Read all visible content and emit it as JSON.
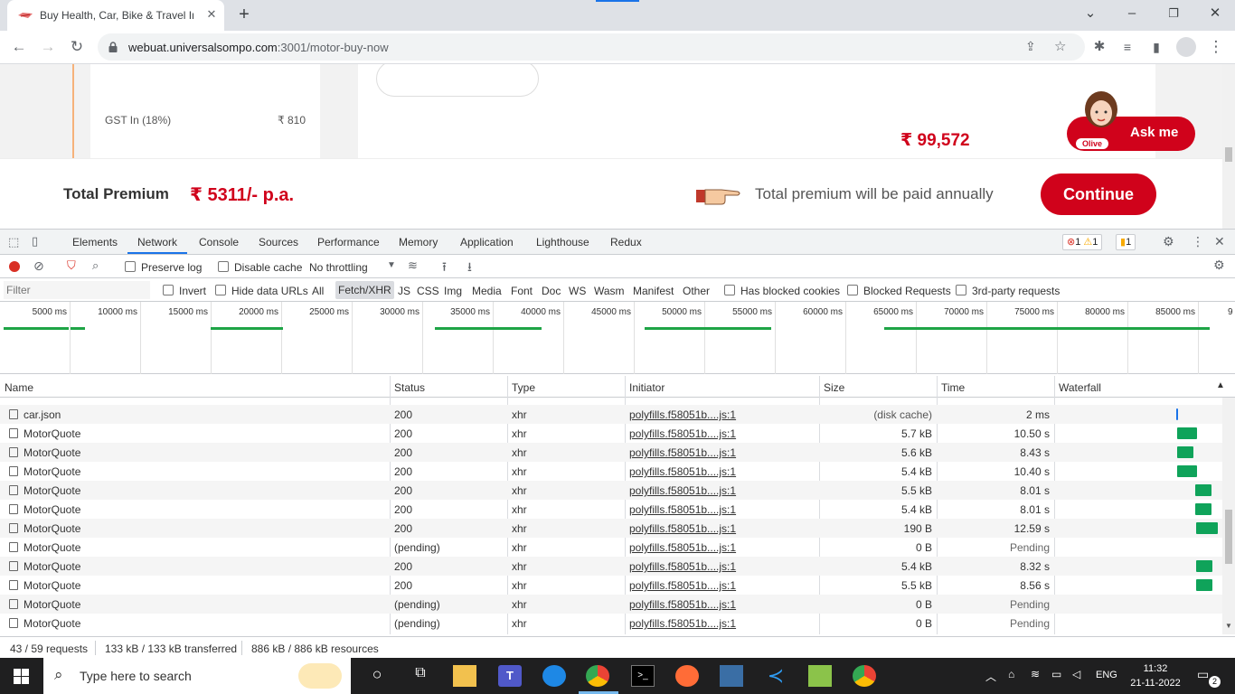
{
  "browser": {
    "tab_title": "Buy Health, Car, Bike & Travel Ins",
    "url_host": "webuat.universalsompo.com",
    "url_path": ":3001/motor-buy-now",
    "window_controls": [
      "minimize",
      "restore",
      "close"
    ]
  },
  "page": {
    "gst_label": "GST In (18%)",
    "gst_value": "₹ 810",
    "plan_price": "₹ 99,572",
    "ask_label": "Ask me",
    "olive_label": "Olive",
    "total_premium_label": "Total Premium",
    "total_premium_value": "₹ 5311/- p.a.",
    "premium_note": "Total premium will be paid annually",
    "continue_label": "Continue"
  },
  "devtools": {
    "tabs": [
      "Elements",
      "Network",
      "Console",
      "Sources",
      "Performance",
      "Memory",
      "Application",
      "Lighthouse",
      "Redux"
    ],
    "active_tab": "Network",
    "errors": "1",
    "warnings": "1",
    "issues": "1",
    "preserve_log": "Preserve log",
    "disable_cache": "Disable cache",
    "throttling": "No throttling",
    "filter_placeholder": "Filter",
    "invert": "Invert",
    "hide_data_urls": "Hide data URLs",
    "type_filters": [
      "All",
      "Fetch/XHR",
      "JS",
      "CSS",
      "Img",
      "Media",
      "Font",
      "Doc",
      "WS",
      "Wasm",
      "Manifest",
      "Other"
    ],
    "active_type": "Fetch/XHR",
    "has_blocked_cookies": "Has blocked cookies",
    "blocked_requests": "Blocked Requests",
    "third_party": "3rd-party requests",
    "timeline_ticks": [
      "5000 ms",
      "10000 ms",
      "15000 ms",
      "20000 ms",
      "25000 ms",
      "30000 ms",
      "35000 ms",
      "40000 ms",
      "45000 ms",
      "50000 ms",
      "55000 ms",
      "60000 ms",
      "65000 ms",
      "70000 ms",
      "75000 ms",
      "80000 ms",
      "85000 ms"
    ],
    "columns": {
      "name": "Name",
      "status": "Status",
      "type": "Type",
      "initiator": "Initiator",
      "size": "Size",
      "time": "Time",
      "waterfall": "Waterfall"
    },
    "requests": [
      {
        "name": "car.json",
        "status": "200",
        "type": "xhr",
        "initiator": "polyfills.f58051b....js:1",
        "size": "(disk cache)",
        "time": "2 ms"
      },
      {
        "name": "MotorQuote",
        "status": "200",
        "type": "xhr",
        "initiator": "polyfills.f58051b....js:1",
        "size": "5.7 kB",
        "time": "10.50 s"
      },
      {
        "name": "MotorQuote",
        "status": "200",
        "type": "xhr",
        "initiator": "polyfills.f58051b....js:1",
        "size": "5.6 kB",
        "time": "8.43 s"
      },
      {
        "name": "MotorQuote",
        "status": "200",
        "type": "xhr",
        "initiator": "polyfills.f58051b....js:1",
        "size": "5.4 kB",
        "time": "10.40 s"
      },
      {
        "name": "MotorQuote",
        "status": "200",
        "type": "xhr",
        "initiator": "polyfills.f58051b....js:1",
        "size": "5.5 kB",
        "time": "8.01 s"
      },
      {
        "name": "MotorQuote",
        "status": "200",
        "type": "xhr",
        "initiator": "polyfills.f58051b....js:1",
        "size": "5.4 kB",
        "time": "8.01 s"
      },
      {
        "name": "MotorQuote",
        "status": "200",
        "type": "xhr",
        "initiator": "polyfills.f58051b....js:1",
        "size": "190 B",
        "time": "12.59 s"
      },
      {
        "name": "MotorQuote",
        "status": "(pending)",
        "type": "xhr",
        "initiator": "polyfills.f58051b....js:1",
        "size": "0 B",
        "time": "Pending"
      },
      {
        "name": "MotorQuote",
        "status": "200",
        "type": "xhr",
        "initiator": "polyfills.f58051b....js:1",
        "size": "5.4 kB",
        "time": "8.32 s"
      },
      {
        "name": "MotorQuote",
        "status": "200",
        "type": "xhr",
        "initiator": "polyfills.f58051b....js:1",
        "size": "5.5 kB",
        "time": "8.56 s"
      },
      {
        "name": "MotorQuote",
        "status": "(pending)",
        "type": "xhr",
        "initiator": "polyfills.f58051b....js:1",
        "size": "0 B",
        "time": "Pending"
      },
      {
        "name": "MotorQuote",
        "status": "(pending)",
        "type": "xhr",
        "initiator": "polyfills.f58051b....js:1",
        "size": "0 B",
        "time": "Pending"
      }
    ],
    "status_requests": "43 / 59 requests",
    "status_transferred": "133 kB / 133 kB transferred",
    "status_resources": "886 kB / 886 kB resources"
  },
  "taskbar": {
    "search_placeholder": "Type here to search",
    "language": "ENG",
    "time": "11:32",
    "date": "21-11-2022",
    "notification_count": "2"
  },
  "colors": {
    "brand_red": "#d0021b",
    "devtools_blue": "#1a73e8",
    "waterfall_green": "#0fa35a"
  }
}
